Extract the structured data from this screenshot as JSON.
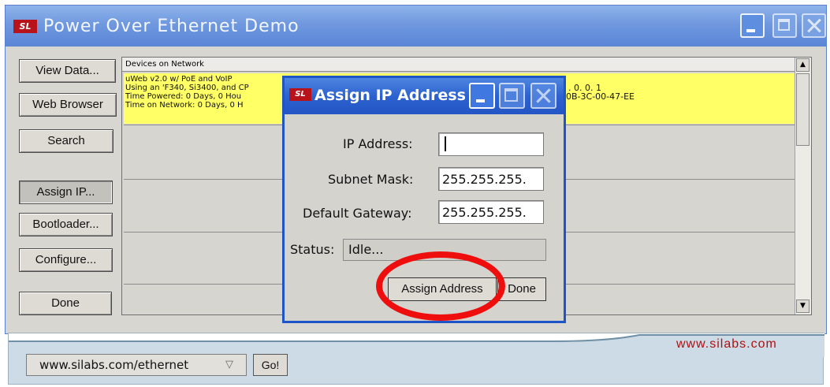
{
  "window": {
    "title": "Power Over Ethernet Demo"
  },
  "sidebar": {
    "view_data": "View Data...",
    "web_browser": "Web Browser",
    "search": "Search",
    "assign_ip": "Assign IP...",
    "bootloader": "Bootloader...",
    "configure": "Configure...",
    "done": "Done"
  },
  "device_list": {
    "header": "Devices on Network",
    "row1_lines": [
      "uWeb v2.0 w/ PoE and VoIP",
      "Using an 'F340, Si3400, and CP",
      "Time Powered: 0 Days,  0 Hou",
      "Time on Network: 0 Days,  0 H"
    ],
    "row1_right": [
      ". 0. 0. 1",
      "0B-3C-00-47-EE"
    ],
    "row1_color": "#ffff66"
  },
  "dialog": {
    "title": "Assign IP Address",
    "ip_label": "IP Address:",
    "ip_value": "",
    "subnet_label": "Subnet Mask:",
    "subnet_value": "255.255.255.",
    "gateway_label": "Default Gateway:",
    "gateway_value": "255.255.255.",
    "status_label": "Status:",
    "status_value": "Idle...",
    "assign_button": "Assign Address",
    "done_button": "Done"
  },
  "annotation": {
    "color": "#ee0e0e"
  },
  "browser": {
    "site_link": "www.silabs.com",
    "url": "www.silabs.com/ethernet",
    "go_button": "Go!"
  },
  "icons": [
    "silabs-logo-icon",
    "minimize-icon",
    "maximize-icon",
    "close-icon",
    "scroll-up-arrow-icon",
    "scroll-down-arrow-icon",
    "dropdown-arrow-icon"
  ]
}
